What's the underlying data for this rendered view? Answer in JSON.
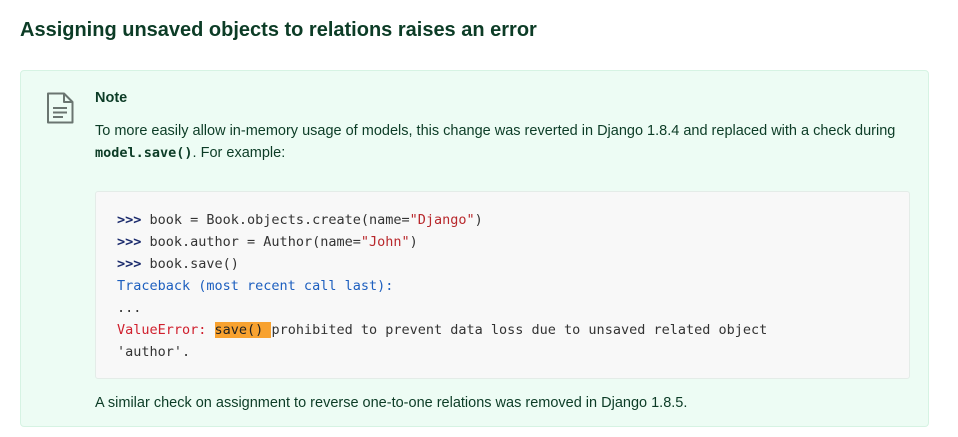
{
  "section": {
    "title": "Assigning unsaved objects to relations raises an error"
  },
  "note": {
    "icon": "document-icon",
    "title": "Note",
    "text_before": "To more easily allow in-memory usage of models, this change was reverted in Django 1.8.4 and replaced with a check during ",
    "inline_code": "model.save()",
    "text_after": ". For example:",
    "footer": "A similar check on assignment to reverse one-to-one relations was removed in Django 1.8.5."
  },
  "code": {
    "prompt": ">>>",
    "line1_pre": " book = Book.objects.create(name=",
    "line1_str": "\"Django\"",
    "line1_post": ")",
    "line2_pre": " book.author = Author(name=",
    "line2_str": "\"John\"",
    "line2_post": ")",
    "line3": " book.save()",
    "traceback": "Traceback (most recent call last):",
    "ellipsis": "...",
    "error_name": "ValueError:",
    "error_highlight": "save() ",
    "error_msg": "prohibited to prevent data loss due to unsaved related object",
    "error_msg2": "'author'."
  },
  "colors": {
    "note_background": "#edfcf4",
    "heading": "#0c3c26",
    "highlight": "#f8a230"
  }
}
